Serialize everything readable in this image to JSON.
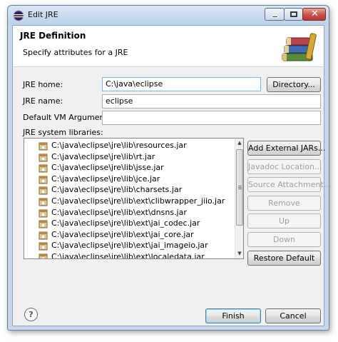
{
  "window": {
    "title": "Edit JRE"
  },
  "banner": {
    "title": "JRE Definition",
    "subtitle": "Specify attributes for a JRE"
  },
  "form": {
    "jre_home_label": "JRE home:",
    "jre_home_value": "C:\\java\\eclipse",
    "directory_button": "Directory...",
    "jre_name_label": "JRE name:",
    "jre_name_value": "eclipse",
    "vm_args_label": "Default VM Arguments:",
    "vm_args_value": "",
    "libraries_label": "JRE system libraries:"
  },
  "libraries": [
    "C:\\java\\eclipse\\jre\\lib\\resources.jar",
    "C:\\java\\eclipse\\jre\\lib\\rt.jar",
    "C:\\java\\eclipse\\jre\\lib\\jsse.jar",
    "C:\\java\\eclipse\\jre\\lib\\jce.jar",
    "C:\\java\\eclipse\\jre\\lib\\charsets.jar",
    "C:\\java\\eclipse\\jre\\lib\\ext\\clibwrapper_jiio.jar",
    "C:\\java\\eclipse\\jre\\lib\\ext\\dnsns.jar",
    "C:\\java\\eclipse\\jre\\lib\\ext\\jai_codec.jar",
    "C:\\java\\eclipse\\jre\\lib\\ext\\jai_core.jar",
    "C:\\java\\eclipse\\jre\\lib\\ext\\jai_imageio.jar",
    "C:\\java\\eclipse\\jre\\lib\\ext\\localedata.jar"
  ],
  "side_buttons": {
    "add_external": "Add External JARs...",
    "javadoc": "Javadoc Location...",
    "source": "Source Attachment...",
    "remove": "Remove",
    "up": "Up",
    "down": "Down",
    "restore": "Restore Default"
  },
  "footer": {
    "help": "?",
    "finish": "Finish",
    "cancel": "Cancel"
  }
}
